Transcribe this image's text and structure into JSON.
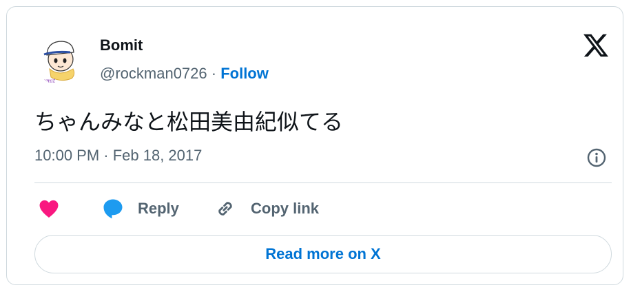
{
  "author": {
    "name": "Bomit",
    "handle": "@rockman0726",
    "separator": " · ",
    "follow_label": "Follow",
    "avatar_signature": "Bomit"
  },
  "tweet": {
    "text": "ちゃんみなと松田美由紀似てる",
    "timestamp": "10:00 PM · Feb 18, 2017"
  },
  "actions": {
    "like_icon": "heart-icon",
    "reply_label": "Reply",
    "reply_icon": "speech-bubble-icon",
    "copy_label": "Copy link",
    "copy_icon": "link-icon"
  },
  "read_more_label": "Read more on X",
  "colors": {
    "link": "#0074d4",
    "secondary_text": "#536471",
    "primary_text": "#0f1419",
    "like": "#f91880",
    "reply": "#1d9bf0",
    "border": "#cfd9de"
  }
}
